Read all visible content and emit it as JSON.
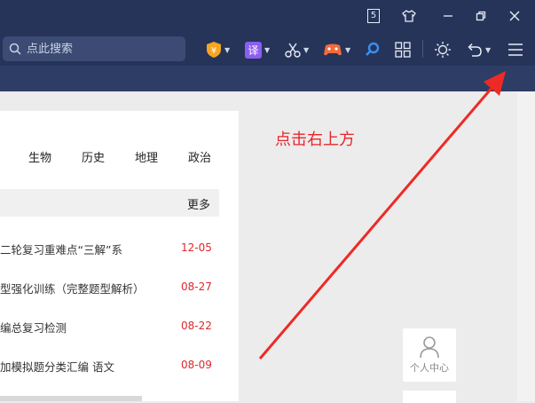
{
  "titlebar": {
    "badge_number": "5"
  },
  "search": {
    "placeholder": "点此搜索"
  },
  "toolbar": {
    "translate_label": "译"
  },
  "subjects": [
    "生物",
    "历史",
    "地理",
    "政治"
  ],
  "more_label": "更多",
  "articles": [
    {
      "title": "二轮复习重难点“三解”系",
      "date": "12-05"
    },
    {
      "title": "型强化训练（完整题型解析）",
      "date": "08-27"
    },
    {
      "title": "编总复习检测",
      "date": "08-22"
    },
    {
      "title": "加模拟题分类汇编 语文",
      "date": "08-09"
    }
  ],
  "annotation": "点击右上方",
  "personal_center": "个人中心",
  "colors": {
    "titlebar": "#26345a",
    "annotation": "#e8262b",
    "date": "#e0262b",
    "arrow": "#ee2a24"
  }
}
